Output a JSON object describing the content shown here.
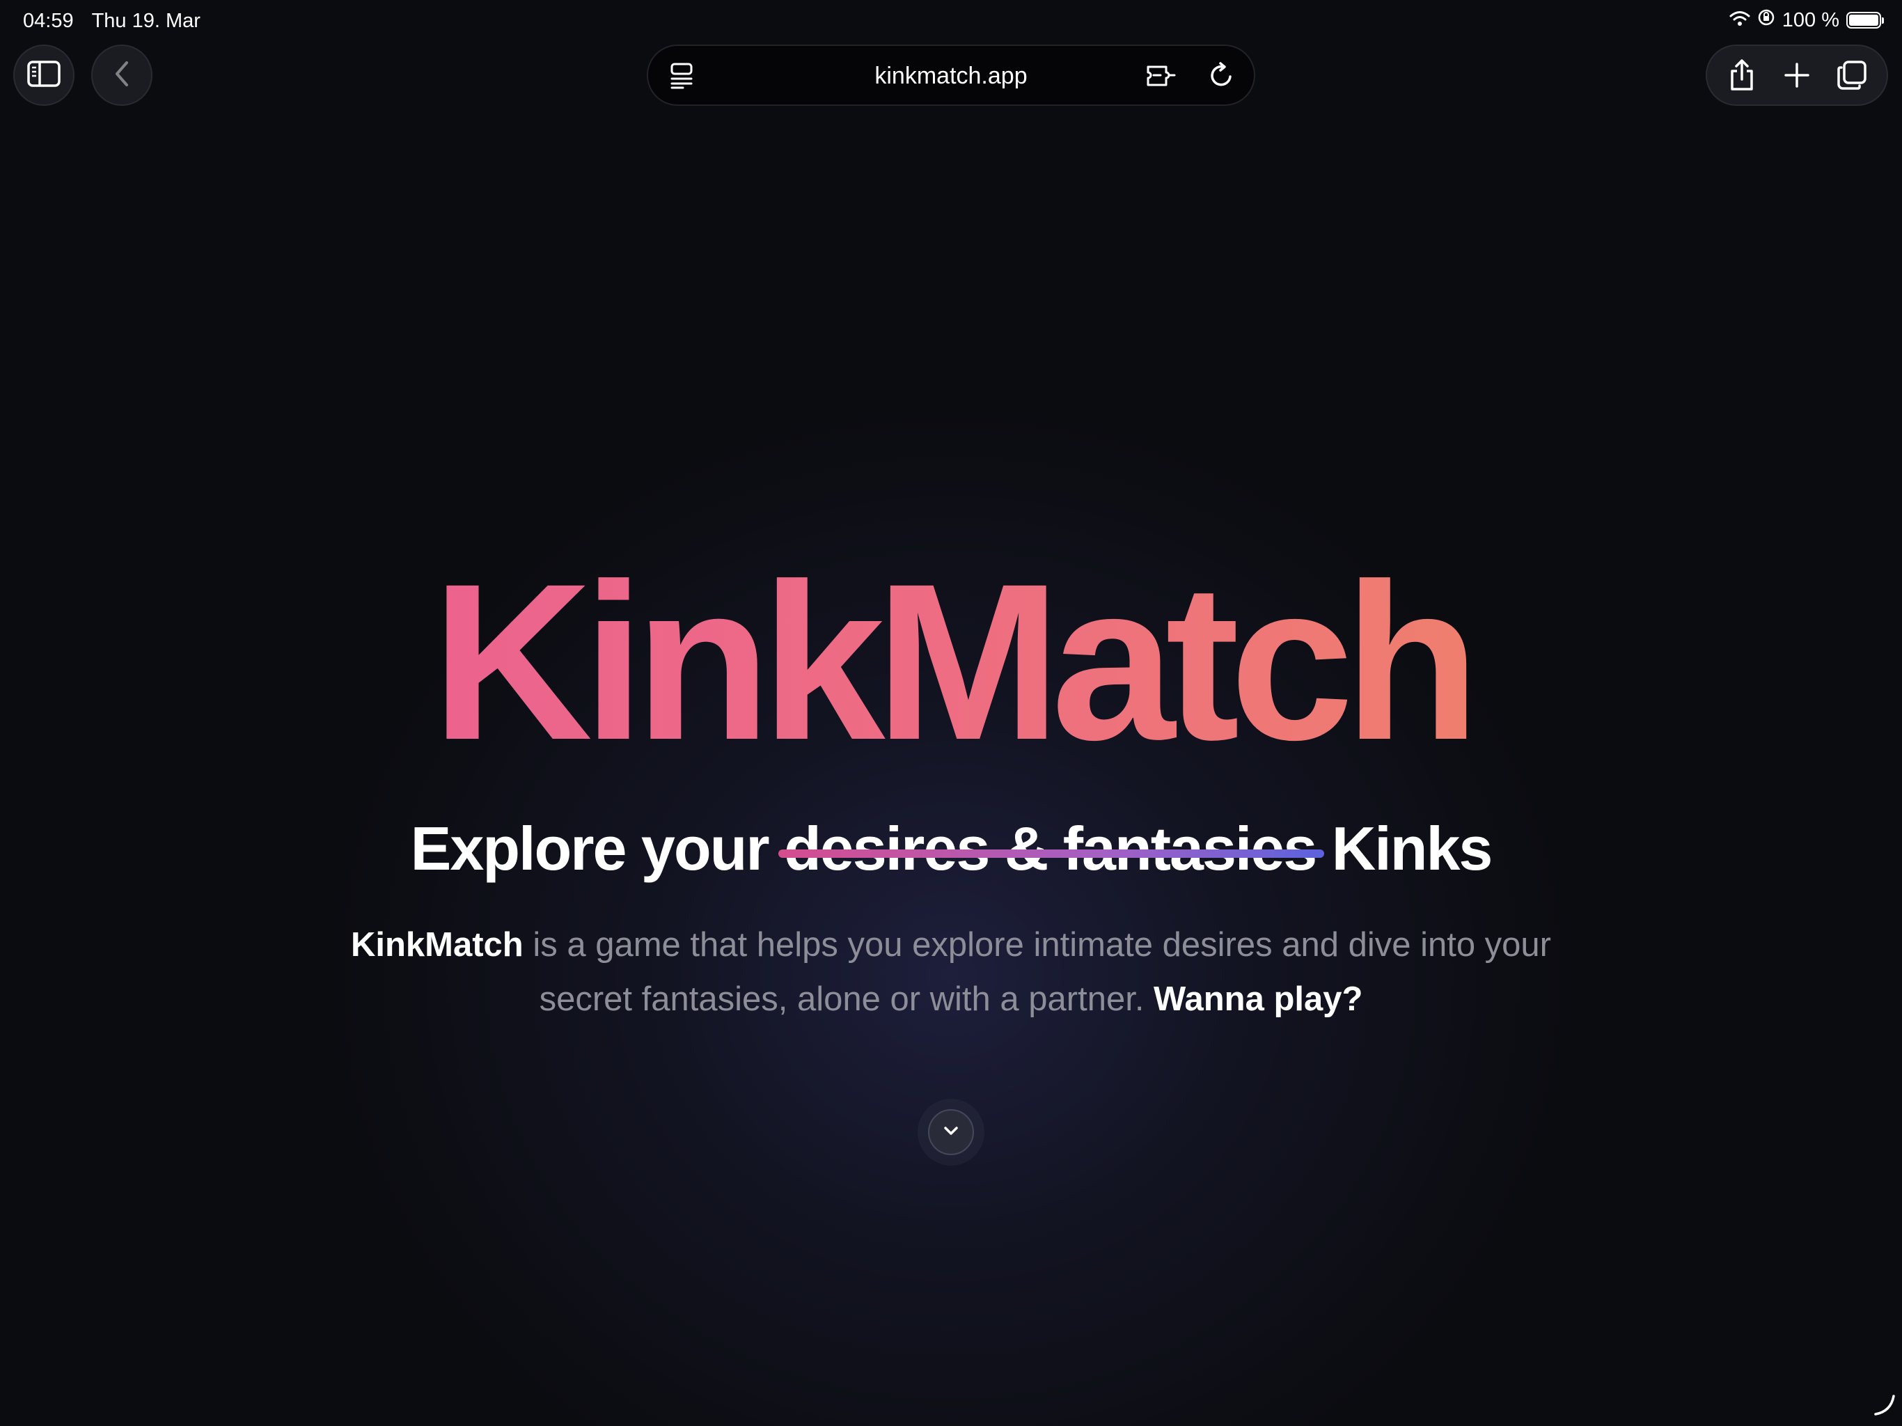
{
  "status_bar": {
    "time": "04:59",
    "date": "Thu 19. Mar",
    "battery": "100 %",
    "icons": [
      "wifi-icon",
      "orientation-lock-icon",
      "battery-icon"
    ]
  },
  "browser": {
    "url": "kinkmatch.app",
    "buttons": [
      "sidebar-icon",
      "back-icon",
      "reader-icon",
      "extension-icon",
      "reload-icon",
      "share-icon",
      "new-tab-icon",
      "tabs-icon"
    ]
  },
  "hero": {
    "title": "KinkMatch",
    "tagline_prefix": "Explore your",
    "tagline_struck": "desires & fantasies",
    "tagline_suffix": "Kinks",
    "description_brand": "KinkMatch",
    "description_body": " is a game that helps you explore intimate desires and dive into your secret fantasies, alone or with a partner. ",
    "description_cta": "Wanna play?"
  },
  "colors": {
    "background": "#0b0c10",
    "title_gradient_start": "#ea5b98",
    "title_gradient_end": "#f08d5e",
    "strike_gradient_start": "#d54d8e",
    "strike_gradient_end": "#5c62dc",
    "muted_text": "#8d8e97"
  }
}
